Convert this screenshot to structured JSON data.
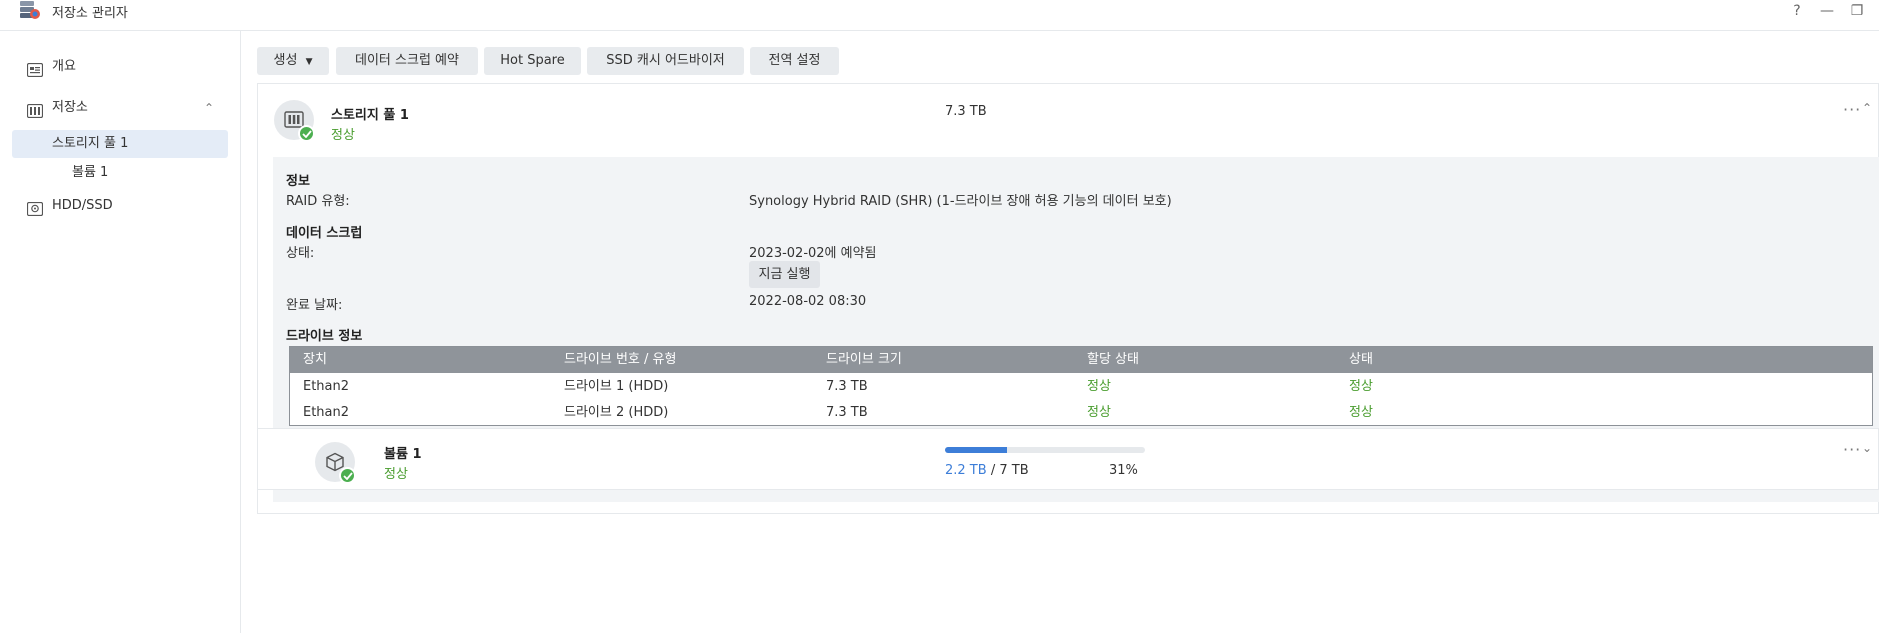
{
  "window": {
    "title": "저장소 관리자",
    "controls": {
      "help": "?",
      "minimize": "—",
      "restore": "❐"
    }
  },
  "sidebar": {
    "items": [
      {
        "label": "개요",
        "icon": "overview-icon"
      },
      {
        "label": "저장소",
        "icon": "storage-icon",
        "expanded": true
      },
      {
        "label": "스토리지 풀 1",
        "selected": true
      },
      {
        "label": "볼륨 1"
      },
      {
        "label": "HDD/SSD",
        "icon": "hdd-icon"
      }
    ]
  },
  "toolbar": {
    "create": "생성",
    "scrub_schedule": "데이터 스크럽 예약",
    "hot_spare": "Hot Spare",
    "ssd_cache": "SSD 캐시 어드바이저",
    "global_settings": "전역 설정"
  },
  "pool": {
    "name": "스토리지 풀 1",
    "status": "정상",
    "size": "7.3 TB",
    "info": {
      "heading": "정보",
      "raid_label": "RAID 유형:",
      "raid_value": "Synology Hybrid RAID (SHR) (1-드라이브 장애 허용 기능의 데이터 보호)"
    },
    "scrub": {
      "heading": "데이터 스크럽",
      "status_label": "상태:",
      "status_value": "2023-02-02에 예약됨",
      "run_now": "지금 실행",
      "completed_label": "완료 날짜:",
      "completed_value": "2022-08-02 08:30"
    },
    "drives": {
      "heading": "드라이브 정보",
      "columns": [
        "장치",
        "드라이브 번호 / 유형",
        "드라이브 크기",
        "할당 상태",
        "상태"
      ],
      "rows": [
        {
          "device": "Ethan2",
          "drive": "드라이브 1 (HDD)",
          "size": "7.3 TB",
          "allocation": "정상",
          "status": "정상"
        },
        {
          "device": "Ethan2",
          "drive": "드라이브 2 (HDD)",
          "size": "7.3 TB",
          "allocation": "정상",
          "status": "정상"
        }
      ]
    }
  },
  "volume": {
    "name": "볼륨 1",
    "status": "정상",
    "used": "2.2 TB",
    "separator": "/",
    "total": "7 TB",
    "percent_label": "31%",
    "usage_fraction": 0.31
  },
  "colors": {
    "accent": "#3d7ed8",
    "ok": "#4a9d2f",
    "table_header": "#8f949a",
    "selected_bg": "#e4ecf7"
  }
}
